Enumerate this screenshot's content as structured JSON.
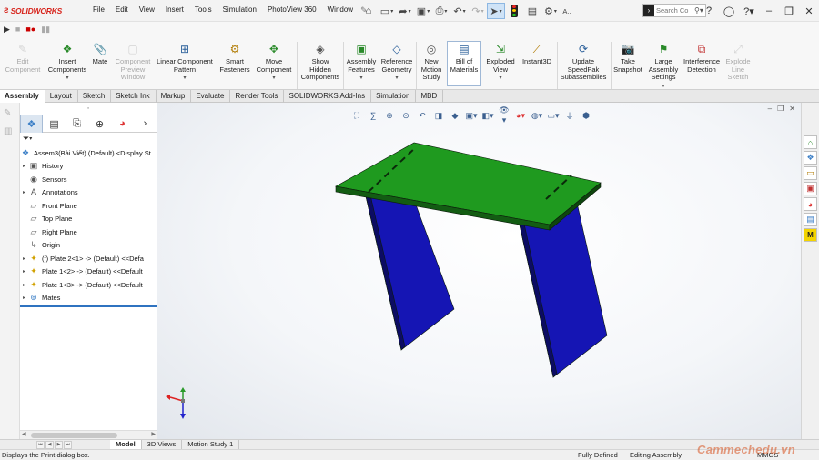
{
  "app": {
    "brand": "SOLIDWORKS",
    "menus": [
      "File",
      "Edit",
      "View",
      "Insert",
      "Tools",
      "Simulation",
      "PhotoView 360",
      "Window"
    ],
    "search_placeholder": "Search Co",
    "search_user_label": "A.."
  },
  "command_manager": {
    "items": [
      {
        "label": "Edit Component",
        "enabled": false
      },
      {
        "label": "Insert Components",
        "enabled": true
      },
      {
        "label": "Mate",
        "enabled": true
      },
      {
        "label": "Component Preview Window",
        "enabled": false
      },
      {
        "label": "Linear Component Pattern",
        "enabled": true
      },
      {
        "label": "Smart Fasteners",
        "enabled": true
      },
      {
        "label": "Move Component",
        "enabled": true
      },
      {
        "label": "Show Hidden Components",
        "enabled": true
      },
      {
        "label": "Assembly Features",
        "enabled": true
      },
      {
        "label": "Reference Geometry",
        "enabled": true
      },
      {
        "label": "New Motion Study",
        "enabled": true
      },
      {
        "label": "Bill of Materials",
        "enabled": true
      },
      {
        "label": "Exploded View",
        "enabled": true
      },
      {
        "label": "Instant3D",
        "enabled": true
      },
      {
        "label": "Update SpeedPak Subassemblies",
        "enabled": true
      },
      {
        "label": "Take Snapshot",
        "enabled": true
      },
      {
        "label": "Large Assembly Settings",
        "enabled": true
      },
      {
        "label": "Interference Detection",
        "enabled": true
      },
      {
        "label": "Explode Line Sketch",
        "enabled": false
      }
    ]
  },
  "tabs": [
    "Assembly",
    "Layout",
    "Sketch",
    "Sketch Ink",
    "Markup",
    "Evaluate",
    "Render Tools",
    "SOLIDWORKS Add-Ins",
    "Simulation",
    "MBD"
  ],
  "active_tab": "Assembly",
  "feature_tree": {
    "root": "Assem3(Bài Viết) (Default) <Display St",
    "items": [
      {
        "label": "History",
        "icon": "history-icon",
        "expandable": true
      },
      {
        "label": "Sensors",
        "icon": "sensors-icon",
        "expandable": false
      },
      {
        "label": "Annotations",
        "icon": "annotations-icon",
        "expandable": true
      },
      {
        "label": "Front Plane",
        "icon": "plane-icon",
        "expandable": false
      },
      {
        "label": "Top Plane",
        "icon": "plane-icon",
        "expandable": false
      },
      {
        "label": "Right Plane",
        "icon": "plane-icon",
        "expandable": false
      },
      {
        "label": "Origin",
        "icon": "origin-icon",
        "expandable": false
      },
      {
        "label": "(f) Plate 2<1> -> (Default) <<Defa",
        "icon": "part-icon",
        "expandable": true
      },
      {
        "label": "Plate 1<2> -> (Default) <<Default",
        "icon": "part-icon",
        "expandable": true
      },
      {
        "label": "Plate 1<3> -> (Default) <<Default",
        "icon": "part-icon",
        "expandable": true
      },
      {
        "label": "Mates",
        "icon": "mates-icon",
        "expandable": true
      }
    ]
  },
  "bottom_tabs": [
    "Model",
    "3D Views",
    "Motion Study 1"
  ],
  "active_bottom_tab": "Model",
  "status": {
    "message": "Displays the Print dialog box.",
    "definition": "Fully Defined",
    "mode": "Editing Assembly",
    "units": "MMGS"
  },
  "watermark": "Cammechedu.vn",
  "colors": {
    "top_plate": "#1f9a1f",
    "legs": "#1515b4",
    "brand": "#d7241c",
    "accent": "#2f73c0"
  }
}
